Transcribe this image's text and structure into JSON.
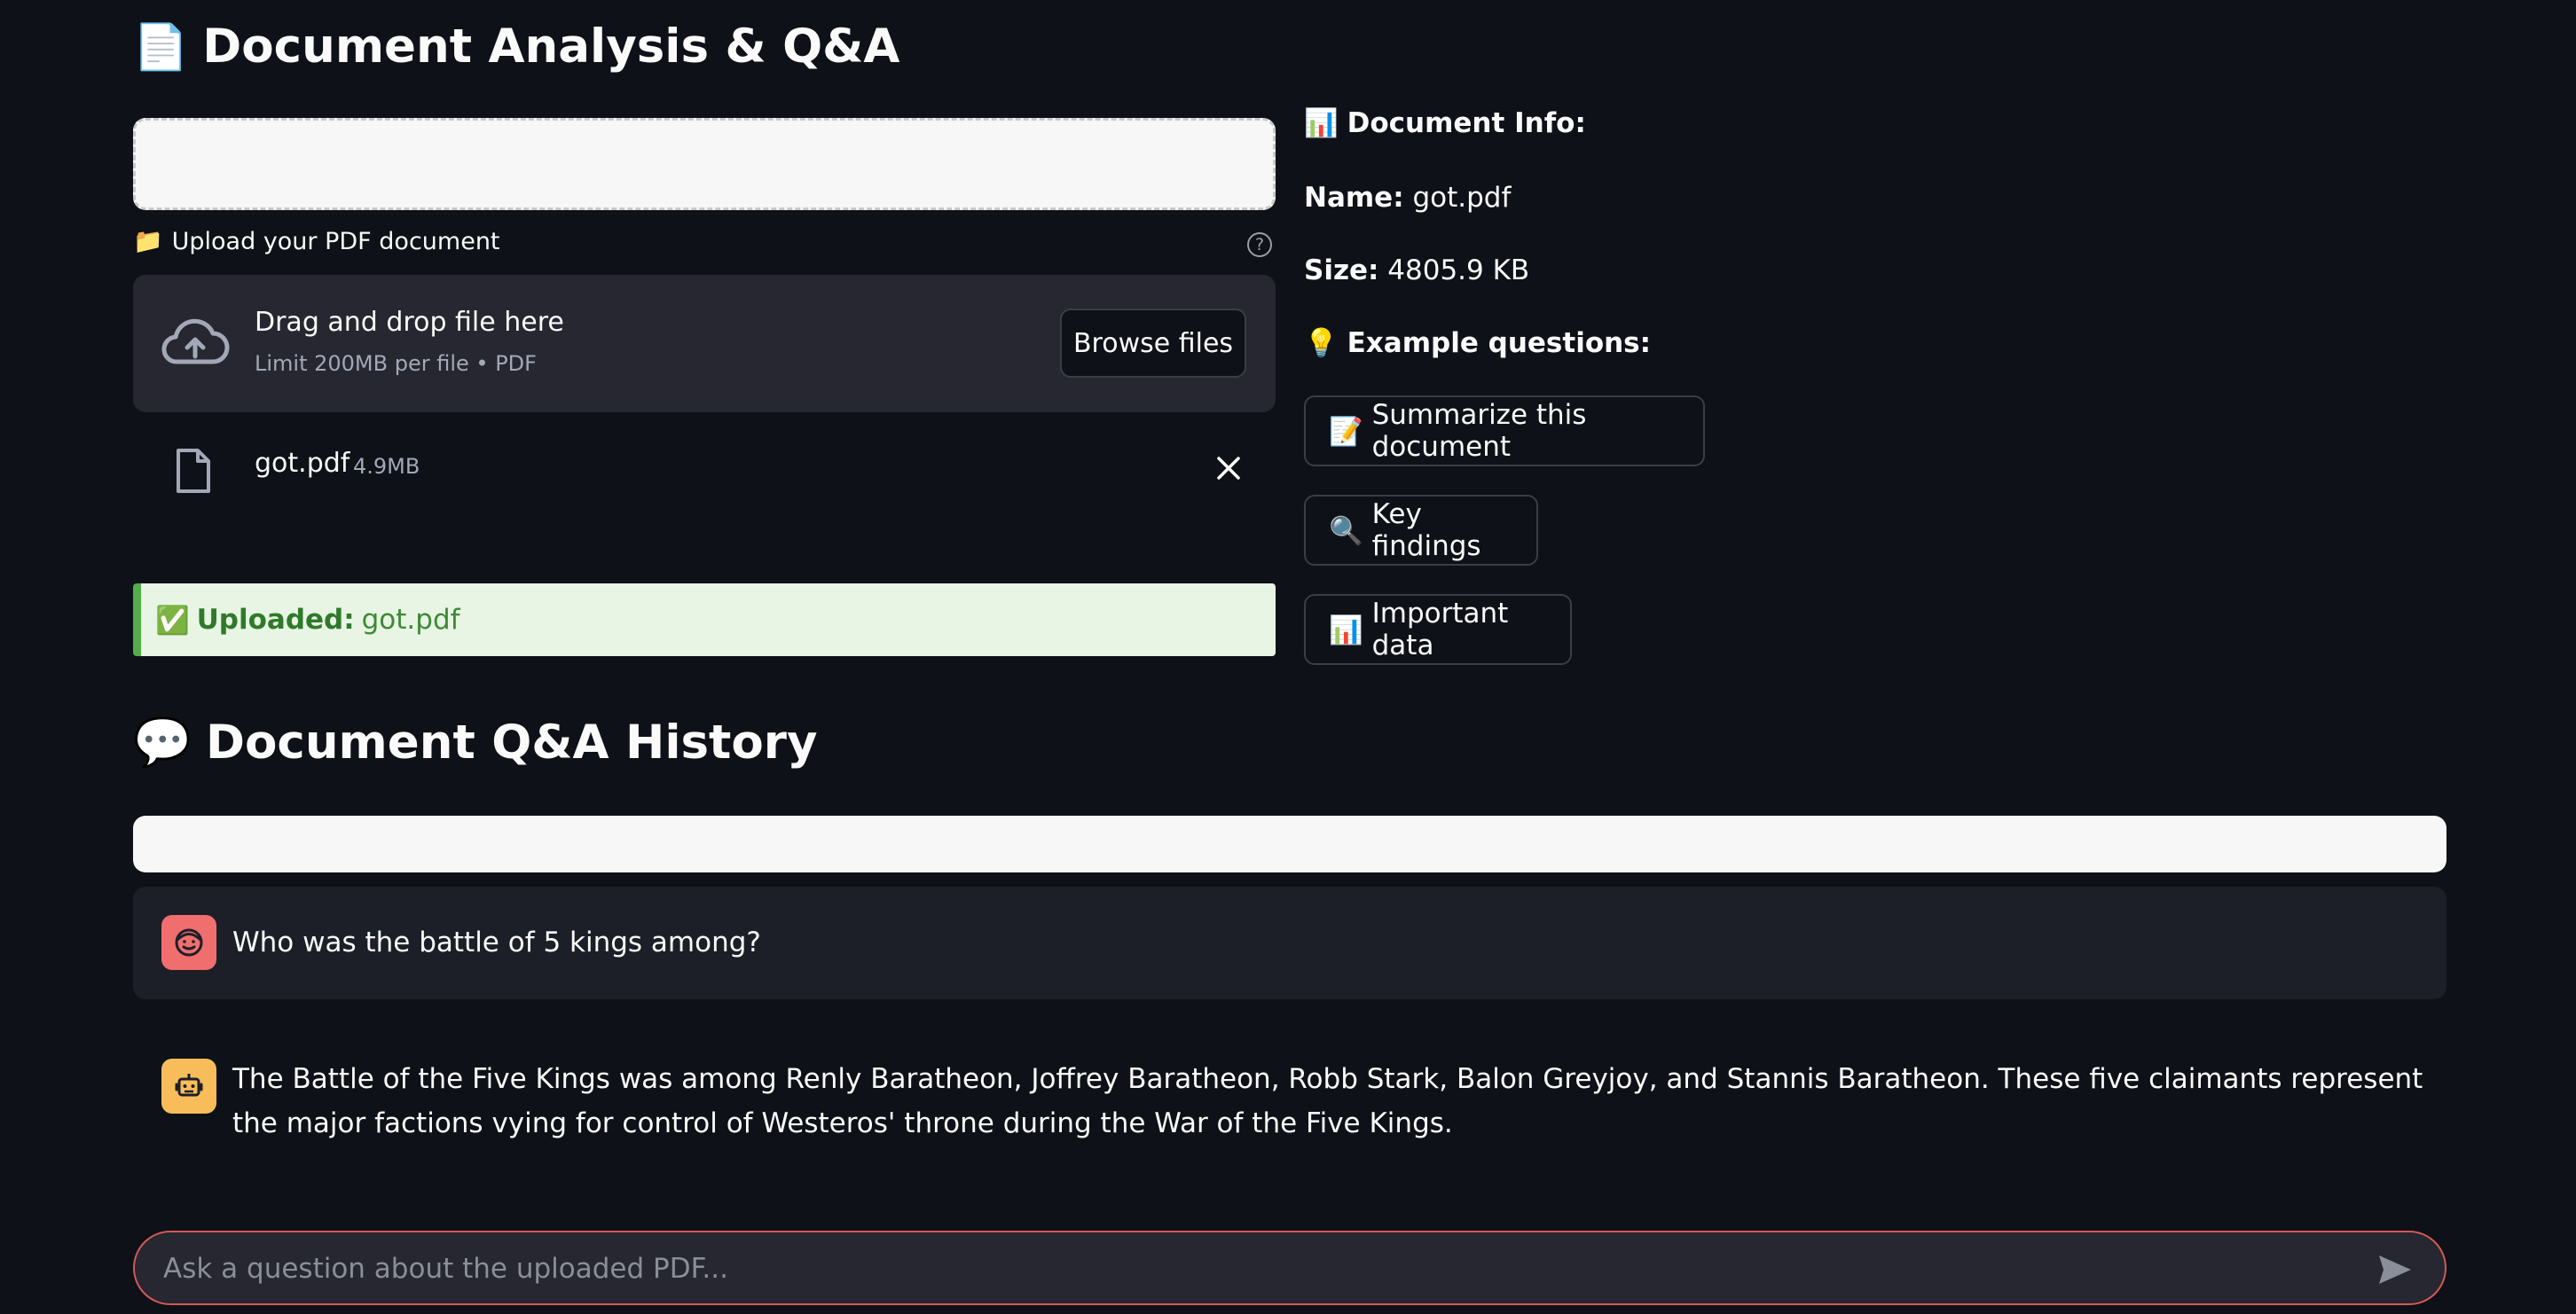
{
  "header": {
    "icon": "document-icon",
    "title": "Document Analysis & Q&A"
  },
  "uploader": {
    "label": "Upload your PDF document",
    "label_icon": "folder-icon",
    "help_icon": "help-circle-icon",
    "dropzone_title": "Drag and drop file here",
    "dropzone_subtitle": "Limit 200MB per file • PDF",
    "browse_label": "Browse files",
    "file": {
      "name": "got.pdf",
      "size": "4.9MB"
    }
  },
  "success_banner": {
    "label": "Uploaded:",
    "value": "got.pdf",
    "color": "#52ad4a"
  },
  "doc_info": {
    "heading": "Document Info:",
    "name_label": "Name:",
    "name_value": "got.pdf",
    "size_label": "Size:",
    "size_value": "4805.9 KB"
  },
  "examples": {
    "heading": "Example questions:",
    "buttons": [
      {
        "icon": "memo",
        "label": "Summarize this document"
      },
      {
        "icon": "magnifier",
        "label": "Key findings"
      },
      {
        "icon": "bar-chart",
        "label": "Important data"
      }
    ]
  },
  "history": {
    "title": "Document Q&A History",
    "messages": [
      {
        "role": "user",
        "text": "Who was the battle of 5 kings among?"
      },
      {
        "role": "assistant",
        "text": "The Battle of the Five Kings was among Renly Baratheon, Joffrey Baratheon, Robb Stark, Balon Greyjoy, and Stannis Baratheon. These five claimants represent the major factions vying for control of Westeros' throne during the War of the Five Kings."
      }
    ]
  },
  "chat_input": {
    "placeholder": "Ask a question about the uploaded PDF..."
  },
  "colors": {
    "background": "#0e1117",
    "user_avatar": "#f06e6e",
    "bot_avatar": "#f8bd5a",
    "input_border": "#d45858"
  }
}
